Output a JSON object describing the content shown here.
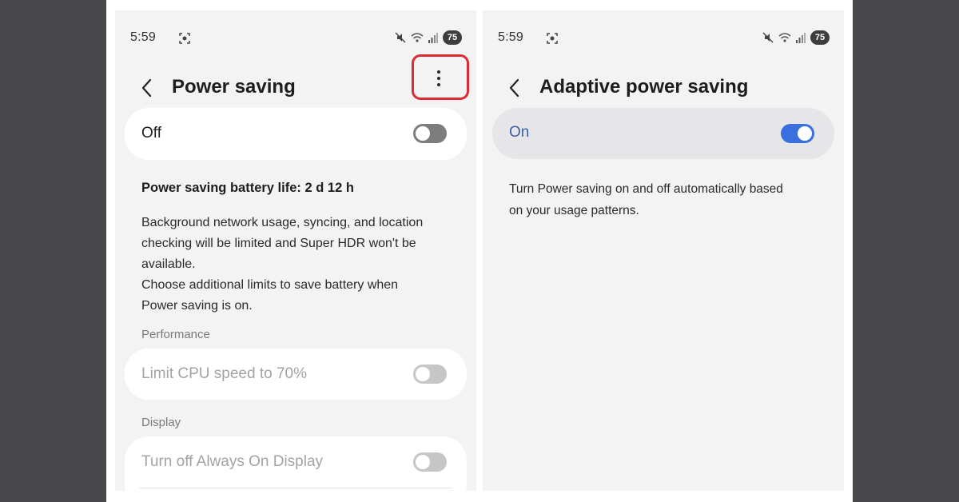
{
  "left_screen": {
    "status": {
      "time": "5:59",
      "battery": "75"
    },
    "header": {
      "title": "Power saving"
    },
    "main_toggle": {
      "label": "Off",
      "state": "off"
    },
    "battery_life": "Power saving battery life: 2 d 12 h",
    "description": {
      "line1": "Background network usage, syncing, and location",
      "line2": "checking will be limited and Super HDR won't be",
      "line3": "available.",
      "line4": "Choose additional limits to save battery when",
      "line5": "Power saving is on."
    },
    "sections": {
      "performance": {
        "label": "Performance",
        "item": {
          "label": "Limit CPU speed to 70%",
          "state": "off",
          "enabled": false
        }
      },
      "display": {
        "label": "Display",
        "item": {
          "label": "Turn off Always On Display",
          "state": "off",
          "enabled": false
        }
      }
    }
  },
  "right_screen": {
    "status": {
      "time": "5:59",
      "battery": "75"
    },
    "header": {
      "title": "Adaptive power saving"
    },
    "main_toggle": {
      "label": "On",
      "state": "on"
    },
    "description": {
      "line1": "Turn Power saving on and off automatically based",
      "line2": "on your usage patterns."
    }
  },
  "colors": {
    "background": "#48484c",
    "screen_bg": "#f3f3f3",
    "highlight_box": "#dd2b34",
    "toggle_on": "#3a6fe0",
    "on_label": "#3d5fa8"
  }
}
